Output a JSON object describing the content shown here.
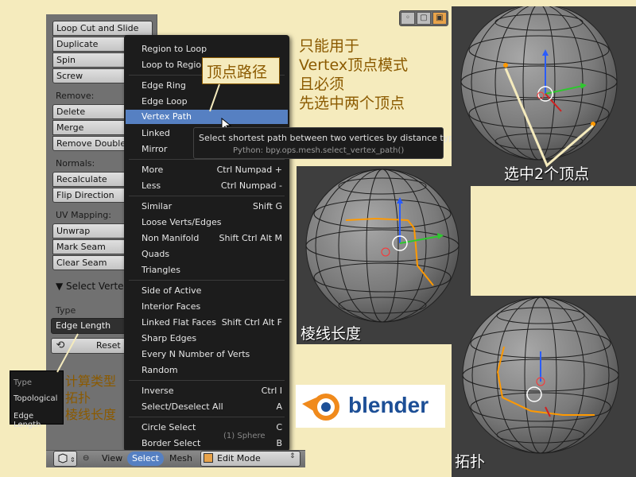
{
  "tool_shelf": {
    "top_buttons": [
      "Loop Cut and Slide",
      "Duplicate",
      "Spin",
      "Screw"
    ],
    "remove_label": "Remove:",
    "remove_buttons": [
      "Delete",
      "Merge",
      "Remove Doubles"
    ],
    "normals_label": "Normals:",
    "normals_buttons": [
      "Recalculate",
      "Flip Direction"
    ],
    "uv_label": "UV Mapping:",
    "uv_buttons": [
      "Unwrap",
      "Mark Seam",
      "Clear Seam"
    ]
  },
  "operator_panel": {
    "title": "▼ Select Vertex Pa",
    "type_label": "Type",
    "type_value": "Edge Length",
    "reset_label": "Reset"
  },
  "type_popup": {
    "title": "Type",
    "options": [
      "Topological",
      "Edge Length"
    ]
  },
  "select_menu": {
    "items": [
      {
        "label": "Region to Loop",
        "shortcut": ""
      },
      {
        "label": "Loop to Region",
        "shortcut": ""
      },
      {
        "label": "Edge Ring",
        "shortcut": ""
      },
      {
        "label": "Edge Loop",
        "shortcut": ""
      },
      {
        "label": "Vertex Path",
        "shortcut": ""
      },
      {
        "label": "Linked",
        "shortcut": "Ctrl L"
      },
      {
        "label": "Mirror",
        "shortcut": ""
      },
      {
        "label": "More",
        "shortcut": "Ctrl Numpad +"
      },
      {
        "label": "Less",
        "shortcut": "Ctrl Numpad -"
      },
      {
        "label": "Similar",
        "shortcut": "Shift G"
      },
      {
        "label": "Loose Verts/Edges",
        "shortcut": ""
      },
      {
        "label": "Non Manifold",
        "shortcut": "Shift Ctrl Alt M"
      },
      {
        "label": "Quads",
        "shortcut": ""
      },
      {
        "label": "Triangles",
        "shortcut": ""
      },
      {
        "label": "Side of Active",
        "shortcut": ""
      },
      {
        "label": "Interior Faces",
        "shortcut": ""
      },
      {
        "label": "Linked Flat Faces",
        "shortcut": "Shift Ctrl Alt F"
      },
      {
        "label": "Sharp Edges",
        "shortcut": ""
      },
      {
        "label": "Every N Number of Verts",
        "shortcut": ""
      },
      {
        "label": "Random",
        "shortcut": ""
      },
      {
        "label": "Inverse",
        "shortcut": "Ctrl I"
      },
      {
        "label": "Select/Deselect All",
        "shortcut": "A"
      },
      {
        "label": "Circle Select",
        "shortcut": "C"
      },
      {
        "label": "Border Select",
        "shortcut": "B"
      }
    ],
    "highlighted": "Vertex Path"
  },
  "tooltip": {
    "description": "Select shortest path between two vertices by distance type",
    "python": "Python: bpy.ops.mesh.select_vertex_path()"
  },
  "header": {
    "view": "View",
    "select": "Select",
    "mesh": "Mesh",
    "mode": "Edit Mode",
    "object_label": "(1) Sphere"
  },
  "annotations": {
    "callout": "顶点路径",
    "note_lines": [
      "只能用于",
      "Vertex顶点模式",
      "且必须",
      "先选中两个顶点"
    ],
    "caption_select": "选中2个顶点",
    "caption_edge_length": "棱线长度",
    "caption_topology": "拓扑",
    "left_notes": [
      "计算类型",
      "拓扑",
      "棱线长度"
    ]
  },
  "logo": {
    "text": "blender"
  },
  "colors": {
    "background": "#f5ebbd",
    "highlight": "#5680c2",
    "annotation": "#8b5a00",
    "selection": "#ff9900"
  }
}
